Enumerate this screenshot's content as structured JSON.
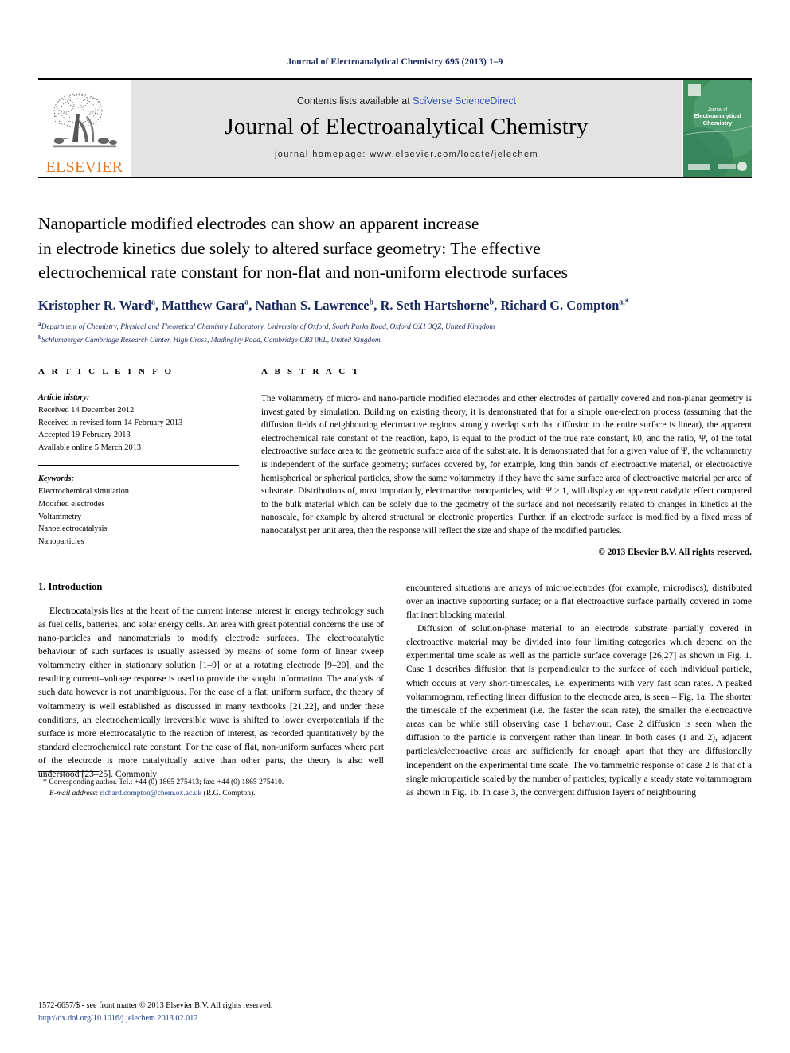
{
  "running_head": "Journal of Electroanalytical Chemistry 695 (2013) 1–9",
  "masthead": {
    "publisher_name": "ELSEVIER",
    "contents_prefix": "Contents lists available at ",
    "contents_link": "SciVerse ScienceDirect",
    "journal_title": "Journal of Electroanalytical Chemistry",
    "homepage_label": "journal homepage: www.elsevier.com/locate/jelechem",
    "cover_title_line1": "Journal of",
    "cover_title_line2": "Electroanalytical",
    "cover_title_line3": "Chemistry"
  },
  "article": {
    "title_line1": "Nanoparticle modified electrodes can show an apparent increase",
    "title_line2": "in electrode kinetics due solely to altered surface geometry: The effective",
    "title_line3": "electrochemical rate constant for non-flat and non-uniform electrode surfaces",
    "authors": [
      {
        "name": "Kristopher R. Ward",
        "sup": "a",
        "sep": ", "
      },
      {
        "name": "Matthew Gara",
        "sup": "a",
        "sep": ", "
      },
      {
        "name": "Nathan S. Lawrence",
        "sup": "b",
        "sep": ", "
      },
      {
        "name": "R. Seth Hartshorne",
        "sup": "b",
        "sep": ", "
      },
      {
        "name": "Richard G. Compton",
        "sup": "a,*",
        "sep": ""
      }
    ],
    "affiliations": [
      {
        "marker": "a",
        "text": "Department of Chemistry, Physical and Theoretical Chemistry Laboratory, University of Oxford, South Parks Road, Oxford OX1 3QZ, United Kingdom"
      },
      {
        "marker": "b",
        "text": "Schlumberger Cambridge Research Center, High Cross, Madingley Road, Cambridge CB3 0EL, United Kingdom"
      }
    ]
  },
  "article_info": {
    "heading": "A R T I C L E    I N F O",
    "history_label": "Article history:",
    "history": [
      "Received 14 December 2012",
      "Received in revised form 14 February 2013",
      "Accepted 19 February 2013",
      "Available online 5 March 2013"
    ],
    "keywords_label": "Keywords:",
    "keywords": [
      "Electrochemical simulation",
      "Modified electrodes",
      "Voltammetry",
      "Nanoelectrocatalysis",
      "Nanoparticles"
    ]
  },
  "abstract": {
    "heading": "A B S T R A C T",
    "text": "The voltammetry of micro- and nano-particle modified electrodes and other electrodes of partially covered and non-planar geometry is investigated by simulation. Building on existing theory, it is demonstrated that for a simple one-electron process (assuming that the diffusion fields of neighbouring electroactive regions strongly overlap such that diffusion to the entire surface is linear), the apparent electrochemical rate constant of the reaction, kapp, is equal to the product of the true rate constant, k0, and the ratio, Ψ, of the total electroactive surface area to the geometric surface area of the substrate. It is demonstrated that for a given value of Ψ, the voltammetry is independent of the surface geometry; surfaces covered by, for example, long thin bands of electroactive material, or electroactive hemispherical or spherical particles, show the same voltammetry if they have the same surface area of electroactive material per area of substrate. Distributions of, most importantly, electroactive nanoparticles, with Ψ > 1, will display an apparent catalytic effect compared to the bulk material which can be solely due to the geometry of the surface and not necessarily related to changes in kinetics at the nanoscale, for example by altered structural or electronic properties. Further, if an electrode surface is modified by a fixed mass of nanocatalyst per unit area, then the response will reflect the size and shape of the modified particles.",
    "copyright": "© 2013 Elsevier B.V. All rights reserved."
  },
  "introduction": {
    "heading": "1. Introduction",
    "left_paragraph": "Electrocatalysis lies at the heart of the current intense interest in energy technology such as fuel cells, batteries, and solar energy cells. An area with great potential concerns the use of nano-particles and nanomaterials to modify electrode surfaces. The electrocatalytic behaviour of such surfaces is usually assessed by means of some form of linear sweep voltammetry either in stationary solution [1–9] or at a rotating electrode [9–20], and the resulting current–voltage response is used to provide the sought information. The analysis of such data however is not unambiguous. For the case of a flat, uniform surface, the theory of voltammetry is well established as discussed in many textbooks [21,22], and under these conditions, an electrochemically irreversible wave is shifted to lower overpotentials if the surface is more electrocatalytic to the reaction of interest, as recorded quantitatively by the standard electrochemical rate constant. For the case of flat, non-uniform surfaces where part of the electrode is more catalytically active than other parts, the theory is also well understood [23–25]. Commonly",
    "right_paragraph_1": "encountered situations are arrays of microelectrodes (for example, microdiscs), distributed over an inactive supporting surface; or a flat electroactive surface partially covered in some flat inert blocking material.",
    "right_paragraph_2": "Diffusion of solution-phase material to an electrode substrate partially covered in electroactive material may be divided into four limiting categories which depend on the experimental time scale as well as the particle surface coverage [26,27] as shown in Fig. 1. Case 1 describes diffusion that is perpendicular to the surface of each individual particle, which occurs at very short-timescales, i.e. experiments with very fast scan rates. A peaked voltammogram, reflecting linear diffusion to the electrode area, is seen – Fig. 1a. The shorter the timescale of the experiment (i.e. the faster the scan rate), the smaller the electroactive areas can be while still observing case 1 behaviour. Case 2 diffusion is seen when the diffusion to the particle is convergent rather than linear. In both cases (1 and 2), adjacent particles/electroactive areas are sufficiently far enough apart that they are diffusionally independent on the experimental time scale. The voltammetric response of case 2 is that of a single microparticle scaled by the number of particles; typically a steady state voltammogram as shown in Fig. 1b. In case 3, the convergent diffusion layers of neighbouring"
  },
  "footnotes": {
    "corresponding_marker": "*",
    "corresponding_text": "Corresponding author. Tel.: +44 (0) 1865 275413; fax: +44 (0) 1865 275410.",
    "email_label": "E-mail address:",
    "email": "richard.compton@chem.ox.ac.uk",
    "email_suffix": "(R.G. Compton)."
  },
  "bottom": {
    "issn_line": "1572-6657/$ - see front matter © 2013 Elsevier B.V. All rights reserved.",
    "doi_line": "http://dx.doi.org/10.1016/j.jelechem.2013.02.012"
  },
  "colors": {
    "link": "#1b3f8f",
    "heading_navy": "#1b2a5e",
    "elsevier_orange": "#E87722",
    "masthead_grey": "#e3e3e3",
    "cover_green": "#3f8f5f"
  }
}
